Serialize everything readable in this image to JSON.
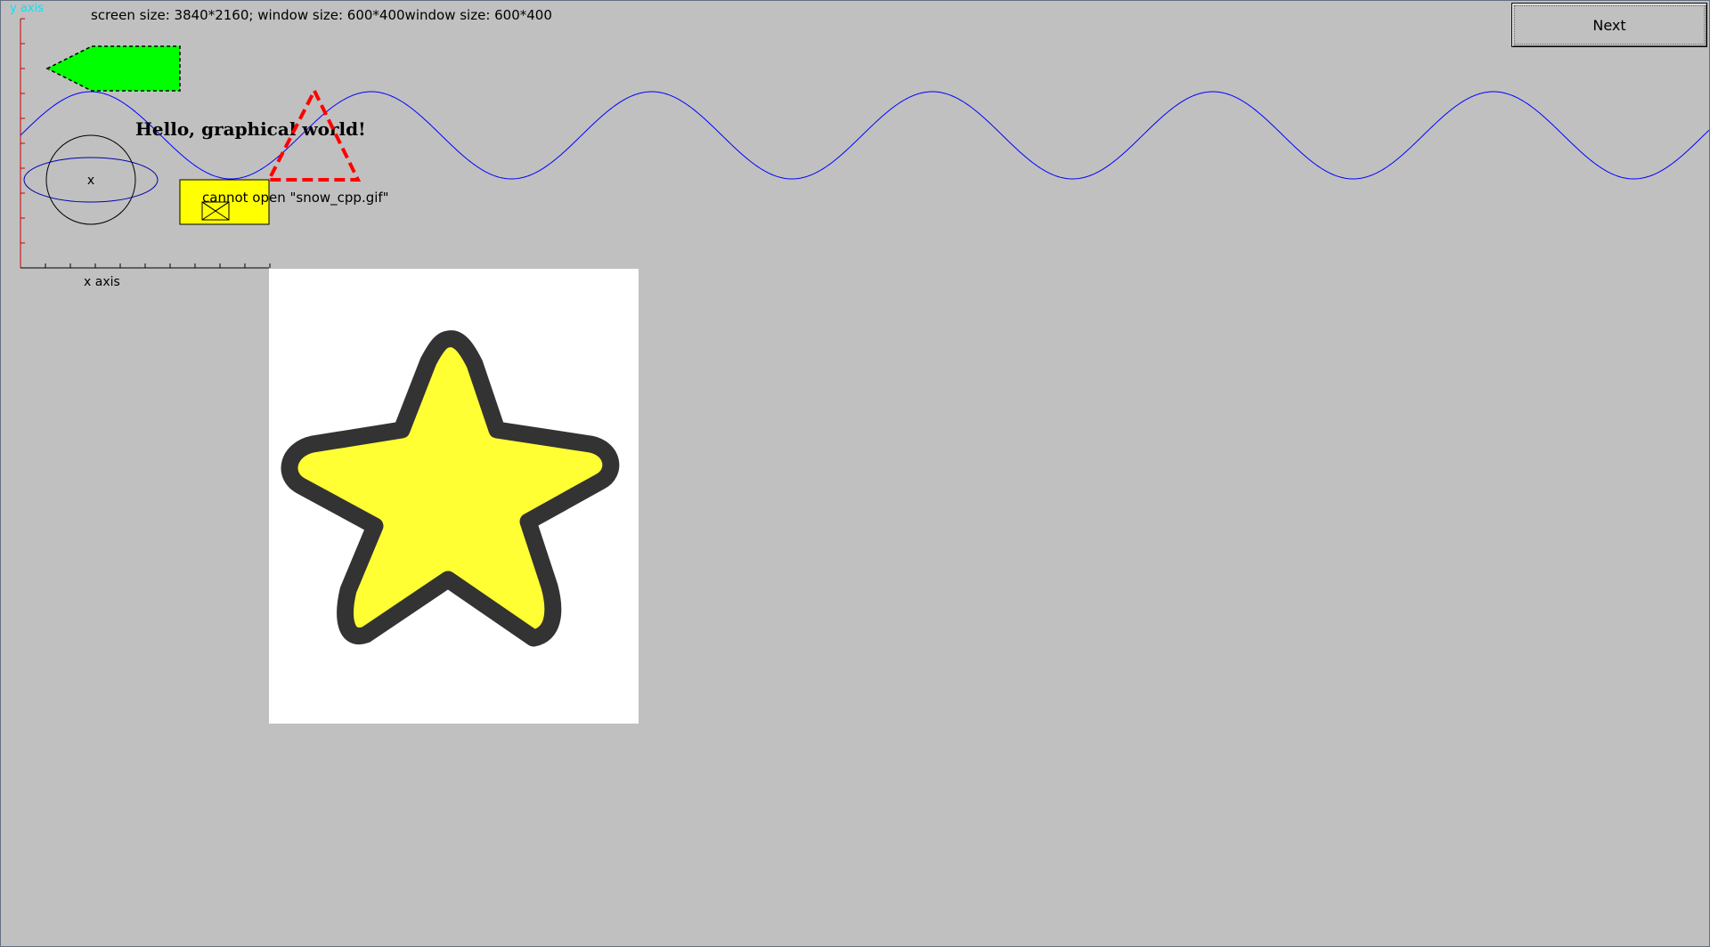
{
  "window": {
    "info_text": "screen size: 3840*2160; window size: 600*400window size: 600*400",
    "next_button_label": "Next"
  },
  "canvas": {
    "y_axis_label": "y axis",
    "x_axis_label": "x axis",
    "hello_text": "Hello, graphical world!",
    "ellipse_center_mark": "x",
    "image_error_text": "cannot open \"snow_cpp.gif\""
  },
  "colors": {
    "background": "#c0c0c0",
    "y_axis": "#ff0000",
    "y_axis_label": "#00ffff",
    "x_axis": "#000000",
    "sine_curve": "#0000ff",
    "arrow_fill": "#00ff00",
    "triangle_stroke": "#ff0000",
    "image_box_fill": "#ffff00",
    "star_fill": "#ffff33",
    "star_outline": "#333333",
    "ellipse_stroke": "#0000aa",
    "circle_stroke": "#000000"
  },
  "icons": {
    "broken_image": "broken-image-icon",
    "star_image": "star-image"
  }
}
